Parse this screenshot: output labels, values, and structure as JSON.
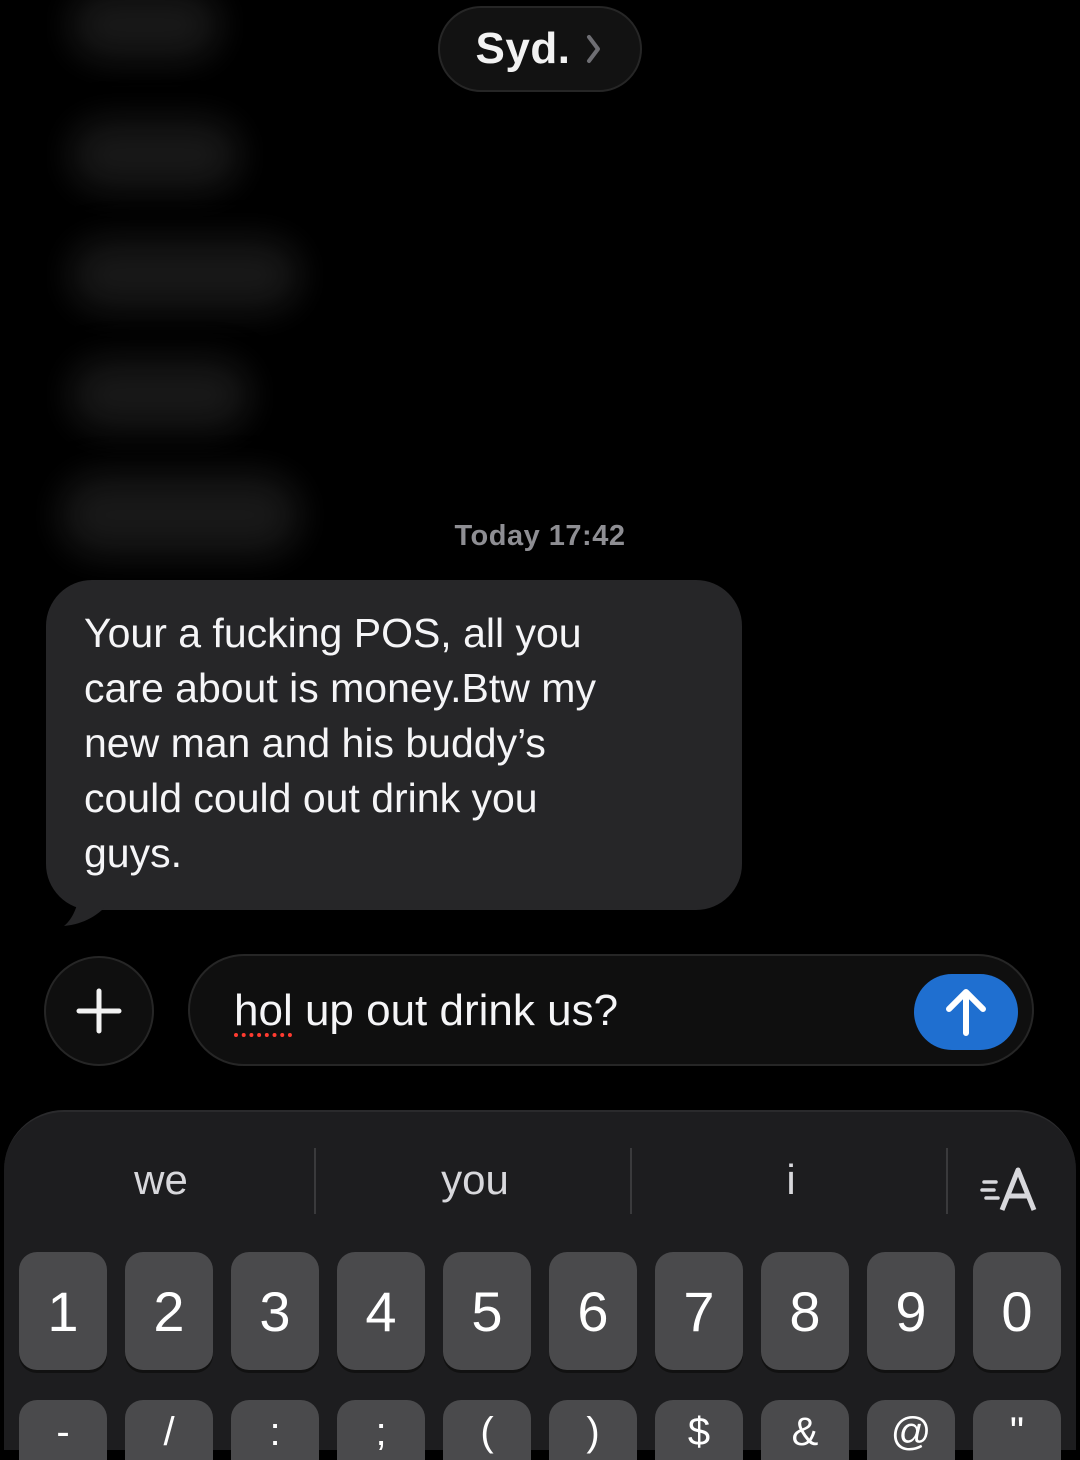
{
  "header": {
    "contact_name": "Syd."
  },
  "conversation": {
    "timestamp": "Today 17:42",
    "incoming_message": "Your a fucking POS, all you\ncare about is money.Btw my\nnew man and his buddy’s\ncould could out drink you\nguys."
  },
  "composer": {
    "text_misspelled": "hol",
    "text_rest": " up out drink us?",
    "accent_color": "#1f6fd0"
  },
  "keyboard": {
    "suggestions": [
      "we",
      "you",
      "i"
    ],
    "number_keys": [
      "1",
      "2",
      "3",
      "4",
      "5",
      "6",
      "7",
      "8",
      "9",
      "0"
    ],
    "symbol_keys_partial": [
      "-",
      "/",
      ":",
      ";",
      "(",
      ")",
      "$",
      "&",
      "@",
      "\""
    ]
  }
}
